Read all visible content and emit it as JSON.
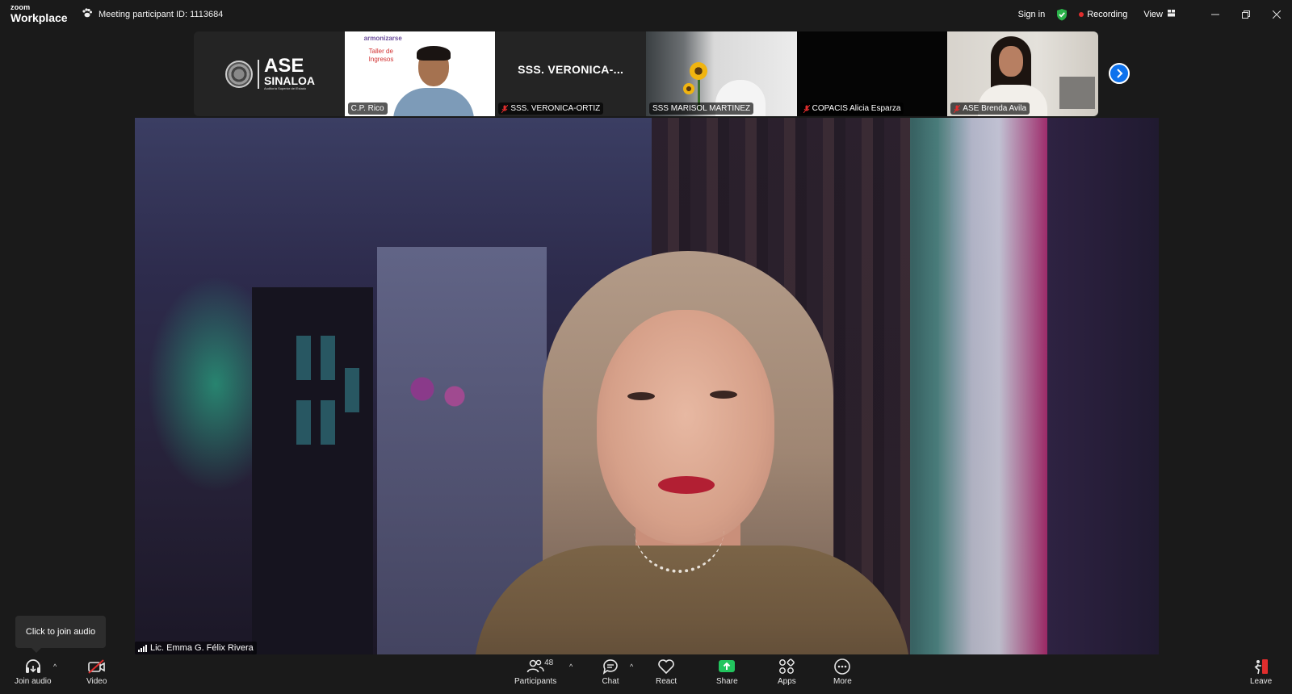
{
  "app": {
    "logo_line1": "zoom",
    "logo_line2": "Workplace",
    "meeting_id_text": "Meeting participant ID: 1113684",
    "signin_label": "Sign in",
    "recording_label": "Recording",
    "view_label": "View"
  },
  "thumbnails": [
    {
      "type": "logo",
      "logo_main": "ASE",
      "logo_sub": "SINALOA",
      "logo_small": "Auditoría Superior del Estado"
    },
    {
      "type": "video",
      "name": "C.P. Rico",
      "slide_brand": "armonizarse",
      "slide_title": "Taller de Ingresos",
      "muted": false
    },
    {
      "type": "name",
      "display_text": "SSS.  VERONICA-...",
      "name": "SSS. VERONICA-ORTIZ",
      "muted": true
    },
    {
      "type": "video",
      "name": "SSS MARISOL MARTINEZ",
      "muted": false
    },
    {
      "type": "black",
      "name": "COPACIS Alicia Esparza",
      "muted": true
    },
    {
      "type": "video",
      "name": "ASE Brenda Avila",
      "muted": true
    }
  ],
  "main_video": {
    "speaker_name": "Lic. Emma G. Félix Rivera"
  },
  "tooltip": {
    "text": "Click to join audio"
  },
  "toolbar": {
    "join_audio_label": "Join audio",
    "video_label": "Video",
    "participants_label": "Participants",
    "participants_count": "48",
    "chat_label": "Chat",
    "react_label": "React",
    "share_label": "Share",
    "apps_label": "Apps",
    "more_label": "More",
    "leave_label": "Leave"
  },
  "colors": {
    "background": "#1a1a1a",
    "accent_blue": "#0e72ed",
    "share_green": "#22c55e",
    "recording_red": "#e02d2d",
    "muted_red": "#e02d2d",
    "shield_green": "#2bb34a"
  }
}
